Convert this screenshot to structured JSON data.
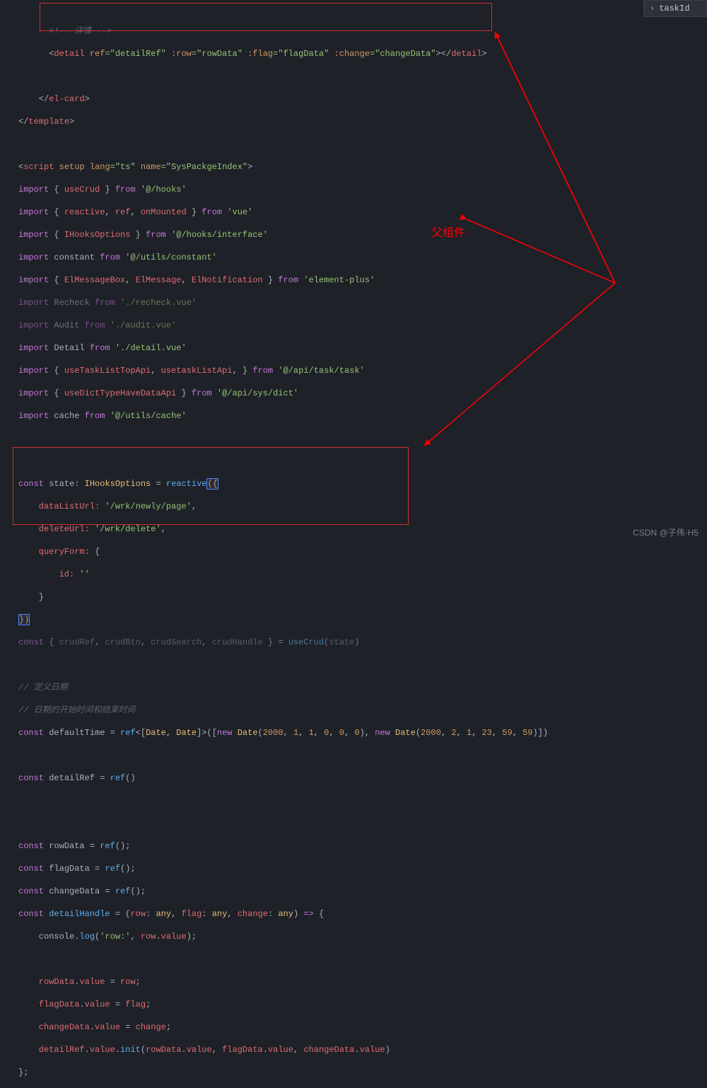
{
  "rightPanel": {
    "label": "taskId"
  },
  "annotation": {
    "label": "父组件"
  },
  "watermark": {
    "text": "CSDN @子伟·H5"
  },
  "code": {
    "l01": "      <!-- 详情 -->",
    "l02a": "      <",
    "l02b": "detail",
    "l02c": " ref",
    "l02d": "=\"detailRef\"",
    "l02e": " :row",
    "l02f": "=\"rowData\"",
    "l02g": " :flag",
    "l02h": "=\"flagData\"",
    "l02i": " :change",
    "l02j": "=\"changeData\"",
    "l02k": "></",
    "l02l": "detail",
    "l02m": ">",
    "l03": "",
    "l04a": "    </",
    "l04b": "el-card",
    "l04c": ">",
    "l05a": "</",
    "l05b": "template",
    "l05c": ">",
    "l06": "",
    "l07a": "<",
    "l07b": "script",
    "l07c": " setup",
    "l07d": " lang",
    "l07e": "=\"ts\"",
    "l07f": " name",
    "l07g": "=\"SysPackgeIndex\"",
    "l07h": ">",
    "l08a": "import",
    "l08b": " { ",
    "l08c": "useCrud",
    "l08d": " } ",
    "l08e": "from",
    "l08f": " '@/hooks'",
    "l09a": "import",
    "l09b": " { ",
    "l09c": "reactive",
    "l09d": ", ",
    "l09e": "ref",
    "l09f": ", ",
    "l09g": "onMounted",
    "l09h": " } ",
    "l09i": "from",
    "l09j": " 'vue'",
    "l10a": "import",
    "l10b": " { ",
    "l10c": "IHooksOptions",
    "l10d": " } ",
    "l10e": "from",
    "l10f": " '@/hooks/interface'",
    "l11a": "import",
    "l11b": " constant ",
    "l11c": "from",
    "l11d": " '@/utils/constant'",
    "l12a": "import",
    "l12b": " { ",
    "l12c": "ElMessageBox",
    "l12d": ", ",
    "l12e": "ElMessage",
    "l12f": ", ",
    "l12g": "ElNotification",
    "l12h": " } ",
    "l12i": "from",
    "l12j": " 'element-plus'",
    "l13a": "import",
    "l13b": " Recheck ",
    "l13c": "from",
    "l13d": " './recheck.vue'",
    "l14a": "import",
    "l14b": " Audit ",
    "l14c": "from",
    "l14d": " './audit.vue'",
    "l15a": "import",
    "l15b": " Detail ",
    "l15c": "from",
    "l15d": " './detail.vue'",
    "l16a": "import",
    "l16b": " { ",
    "l16c": "useTaskListTopApi",
    "l16d": ", ",
    "l16e": "usetaskListApi",
    "l16f": ", } ",
    "l16g": "from",
    "l16h": " '@/api/task/task'",
    "l17a": "import",
    "l17b": " { ",
    "l17c": "useDictTypeHaveDataApi",
    "l17d": " } ",
    "l17e": "from",
    "l17f": " '@/api/sys/dict'",
    "l18a": "import",
    "l18b": " cache ",
    "l18c": "from",
    "l18d": " '@/utils/cache'",
    "l19": "",
    "l20": "",
    "l21a": "const",
    "l21b": " state",
    "l21c": ": ",
    "l21d": "IHooksOptions",
    "l21e": " = ",
    "l21f": "reactive",
    "l21g": "({",
    "l22a": "    dataListUrl:",
    "l22b": " '/wrk/newly/page'",
    "l22c": ",",
    "l23a": "    deleteUrl:",
    "l23b": " '/wrk/delete'",
    "l23c": ",",
    "l24a": "    queryForm:",
    "l24b": " {",
    "l25a": "        id:",
    "l25b": " ''",
    "l26": "    }",
    "l27": "})",
    "l28a": "const",
    "l28b": " { ",
    "l28c": "crudRef",
    "l28d": ", ",
    "l28e": "crudBtn",
    "l28f": ", ",
    "l28g": "crudSearch",
    "l28h": ", ",
    "l28i": "crudHandle",
    "l28j": " } = ",
    "l28k": "useCrud",
    "l28l": "(",
    "l28m": "state",
    "l28n": ")",
    "l29": "",
    "l30": "// 定义日期",
    "l31": "// 日期的开始时间和结束时间",
    "l32a": "const",
    "l32b": " defaultTime",
    "l32c": " = ",
    "l32d": "ref",
    "l32e": "<[",
    "l32f": "Date",
    "l32g": ", ",
    "l32h": "Date",
    "l32i": "]>([",
    "l32j": "new",
    "l32k": " Date",
    "l32l": "(",
    "l32m": "2000",
    "l32n": ", ",
    "l32o": "1",
    "l32p": ", ",
    "l32q": "1",
    "l32r": ", ",
    "l32s": "0",
    "l32t": ", ",
    "l32u": "0",
    "l32v": ", ",
    "l32w": "0",
    "l32x": "), ",
    "l32y": "new",
    "l32z": " Date",
    "l32aa": "(",
    "l32ab": "2000",
    "l32ac": ", ",
    "l32ad": "2",
    "l32ae": ", ",
    "l32af": "1",
    "l32ag": ", ",
    "l32ah": "23",
    "l32ai": ", ",
    "l32aj": "59",
    "l32ak": ", ",
    "l32al": "59",
    "l32am": ")])",
    "l33": "",
    "l34a": "const",
    "l34b": " detailRef",
    "l34c": " = ",
    "l34d": "ref",
    "l34e": "()",
    "l35": "",
    "l36": "",
    "l37a": "const",
    "l37b": " rowData",
    "l37c": " = ",
    "l37d": "ref",
    "l37e": "();",
    "l38a": "const",
    "l38b": " flagData",
    "l38c": " = ",
    "l38d": "ref",
    "l38e": "();",
    "l39a": "const",
    "l39b": " changeData",
    "l39c": " = ",
    "l39d": "ref",
    "l39e": "();",
    "l40a": "const",
    "l40b": " detailHandle",
    "l40c": " = (",
    "l40d": "row",
    "l40e": ": ",
    "l40f": "any",
    "l40g": ", ",
    "l40h": "flag",
    "l40i": ": ",
    "l40j": "any",
    "l40k": ", ",
    "l40l": "change",
    "l40m": ": ",
    "l40n": "any",
    "l40o": ") ",
    "l40p": "=>",
    "l40q": " {",
    "l41a": "    console",
    "l41b": ".",
    "l41c": "log",
    "l41d": "(",
    "l41e": "'row:'",
    "l41f": ", ",
    "l41g": "row",
    "l41h": ".",
    "l41i": "value",
    "l41j": ");",
    "l42": "",
    "l43a": "    rowData",
    "l43b": ".",
    "l43c": "value",
    "l43d": " = ",
    "l43e": "row",
    "l43f": ";",
    "l44a": "    flagData",
    "l44b": ".",
    "l44c": "value",
    "l44d": " = ",
    "l44e": "flag",
    "l44f": ";",
    "l45a": "    changeData",
    "l45b": ".",
    "l45c": "value",
    "l45d": " = ",
    "l45e": "change",
    "l45f": ";",
    "l46a": "    detailRef",
    "l46b": ".",
    "l46c": "value",
    "l46d": ".",
    "l46e": "init",
    "l46f": "(",
    "l46g": "rowData",
    "l46h": ".",
    "l46i": "value",
    "l46j": ", ",
    "l46k": "flagData",
    "l46l": ".",
    "l46m": "value",
    "l46n": ", ",
    "l46o": "changeData",
    "l46p": ".",
    "l46q": "value",
    "l46r": ")",
    "l47": "};"
  }
}
